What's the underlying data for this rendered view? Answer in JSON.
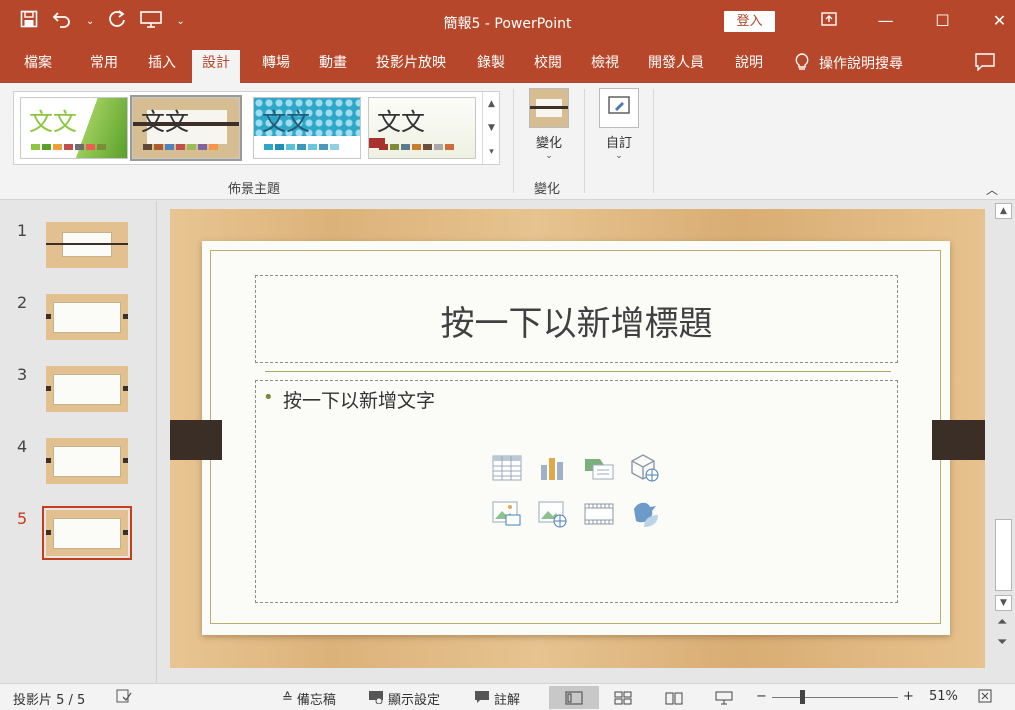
{
  "app": {
    "document_title": "簡報5 - PowerPoint",
    "signin_label": "登入",
    "icons": {
      "save": "save-icon",
      "undo": "undo-icon",
      "redo": "redo-icon",
      "present": "present-from-start-icon",
      "customize": "chevron-down-icon"
    }
  },
  "tabs": [
    {
      "label": "檔案"
    },
    {
      "label": "常用"
    },
    {
      "label": "插入"
    },
    {
      "label": "設計",
      "active": true
    },
    {
      "label": "轉場"
    },
    {
      "label": "動畫"
    },
    {
      "label": "投影片放映"
    },
    {
      "label": "錄製"
    },
    {
      "label": "校閱"
    },
    {
      "label": "檢視"
    },
    {
      "label": "開發人員"
    },
    {
      "label": "說明"
    }
  ],
  "help_search": {
    "label": "操作說明搜尋"
  },
  "ribbon": {
    "themes_group_label": "佈景主題",
    "theme_sample_text": "文文",
    "variants_group_label": "變化",
    "variants_button_label": "變化",
    "customize_button_label": "自訂",
    "themes": [
      {
        "name": "green-facet",
        "swatches": [
          "#8dc63f",
          "#5aa02c",
          "#f29d38",
          "#c0504d",
          "#6e6e6e",
          "#ee5d53",
          "#7b8c3b",
          "#dbdb54"
        ]
      },
      {
        "name": "wood-type",
        "swatches": [
          "#5b4a3a",
          "#b05a2f",
          "#4f81bd",
          "#c0504d",
          "#9bbb59",
          "#8064a2",
          "#f79646",
          "#95b3d7"
        ]
      },
      {
        "name": "blue-pattern",
        "swatches": [
          "#2ea7c8",
          "#1f8fb5",
          "#57c5d9",
          "#3a98b9",
          "#6bc7e0",
          "#4c9bbd",
          "#8ed1e3",
          "#2c6e8a"
        ]
      },
      {
        "name": "retrospect-red",
        "swatches": [
          "#a7322e",
          "#7e8c3a",
          "#5c7a8a",
          "#c97e2a",
          "#6b4e3a",
          "#a8a8a8",
          "#cf6d3a",
          "#8f9c5a"
        ]
      }
    ]
  },
  "slides_pane": [
    {
      "number": "1",
      "active": false
    },
    {
      "number": "2",
      "active": false
    },
    {
      "number": "3",
      "active": false
    },
    {
      "number": "4",
      "active": false
    },
    {
      "number": "5",
      "active": true
    }
  ],
  "slide": {
    "title_placeholder": "按一下以新增標題",
    "body_placeholder": "按一下以新增文字",
    "bullet": "•",
    "insert_icons": [
      "insert-table-icon",
      "insert-chart-icon",
      "insert-smartart-icon",
      "insert-3d-model-icon",
      "insert-picture-icon",
      "insert-online-picture-icon",
      "insert-video-icon",
      "insert-icons-icon"
    ]
  },
  "status": {
    "slide_counter": "投影片 5 / 5",
    "notes_label": "備忘稿",
    "display_settings_label": "顯示設定",
    "comments_label": "註解",
    "zoom_percent": "51%",
    "zoom_minus": "−",
    "zoom_plus": "+"
  }
}
